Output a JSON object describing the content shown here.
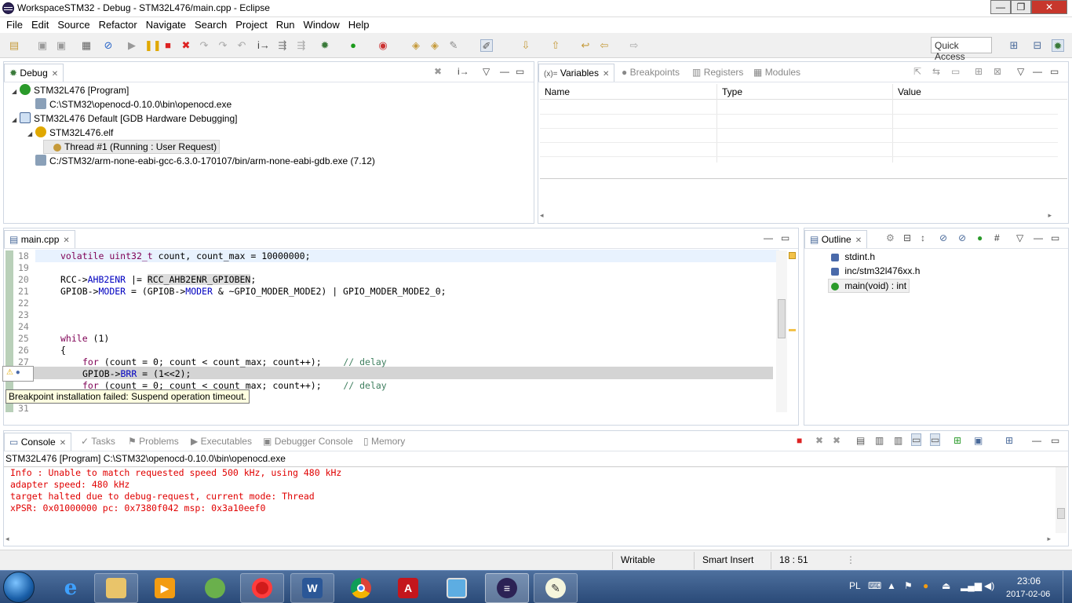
{
  "window": {
    "title": "WorkspaceSTM32 - Debug - STM32L476/main.cpp - Eclipse",
    "min": "—",
    "max": "❐",
    "close": "✕"
  },
  "menu": [
    "File",
    "Edit",
    "Source",
    "Refactor",
    "Navigate",
    "Search",
    "Project",
    "Run",
    "Window",
    "Help"
  ],
  "toolbar": {
    "quick_access": "Quick Access"
  },
  "debug_view": {
    "tab": "Debug",
    "items": [
      {
        "label": "STM32L476 [Program]"
      },
      {
        "label": "C:\\STM32\\openocd-0.10.0\\bin\\openocd.exe"
      },
      {
        "label": "STM32L476 Default [GDB Hardware Debugging]"
      },
      {
        "label": "STM32L476.elf"
      },
      {
        "label": "Thread #1 (Running : User Request)"
      },
      {
        "label": "C:/STM32/arm-none-eabi-gcc-6.3.0-170107/bin/arm-none-eabi-gdb.exe (7.12)"
      }
    ]
  },
  "variables_view": {
    "tabs": [
      "Variables",
      "Breakpoints",
      "Registers",
      "Modules"
    ],
    "columns": [
      "Name",
      "Type",
      "Value"
    ]
  },
  "editor": {
    "tab": "main.cpp",
    "lines": [
      {
        "n": "18",
        "text": "volatile uint32_t count, count_max = 10000000;"
      },
      {
        "n": "19",
        "text": ""
      },
      {
        "n": "20",
        "text": "RCC->AHB2ENR |= RCC_AHB2ENR_GPIOBEN;"
      },
      {
        "n": "21",
        "text": "GPIOB->MODER = (GPIOB->MODER & ~GPIO_MODER_MODE2) | GPIO_MODER_MODE2_0;"
      },
      {
        "n": "22",
        "text": ""
      },
      {
        "n": "23",
        "text": ""
      },
      {
        "n": "24",
        "text": ""
      },
      {
        "n": "25",
        "text": "while (1)"
      },
      {
        "n": "26",
        "text": "{"
      },
      {
        "n": "27",
        "text": "for (count = 0; count < count_max; count++);    // delay"
      },
      {
        "n": "28",
        "text": "GPIOB->BRR = (1<<2);"
      },
      {
        "n": "29",
        "text": "for (count = 0; count < count_max; count++);    // delay"
      },
      {
        "n": "31",
        "text": ""
      }
    ],
    "tooltip": "Breakpoint installation failed: Suspend operation timeout."
  },
  "outline_view": {
    "tab": "Outline",
    "items": [
      "stdint.h",
      "inc/stm32l476xx.h",
      "main(void) : int"
    ]
  },
  "console_view": {
    "tabs": [
      "Console",
      "Tasks",
      "Problems",
      "Executables",
      "Debugger Console",
      "Memory"
    ],
    "process": "STM32L476 [Program] C:\\STM32\\openocd-0.10.0\\bin\\openocd.exe",
    "lines": [
      "Info : Unable to match requested speed 500 kHz, using 480 kHz",
      "adapter speed: 480 kHz",
      "target halted due to debug-request, current mode: Thread",
      "xPSR: 0x01000000 pc: 0x7380f042 msp: 0x3a10eef0"
    ]
  },
  "status": {
    "writable": "Writable",
    "insert": "Smart Insert",
    "position": "18 : 51"
  },
  "taskbar": {
    "lang": "PL",
    "time": "23:06",
    "date": "2017-02-06"
  }
}
